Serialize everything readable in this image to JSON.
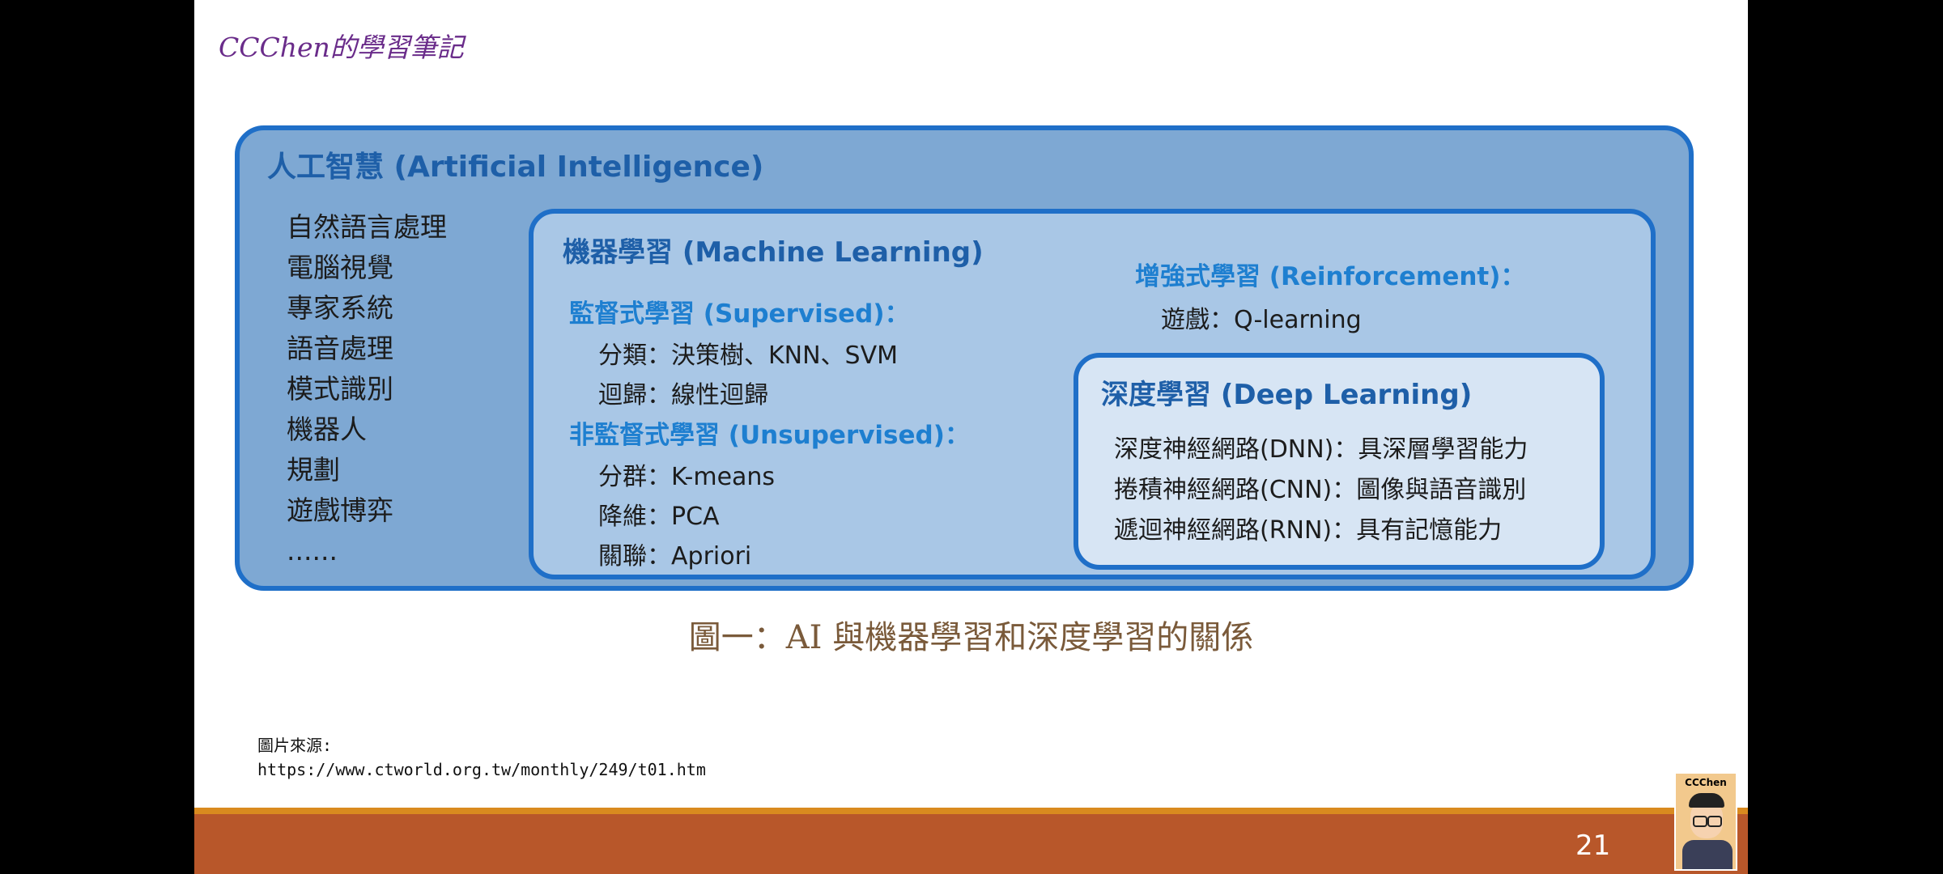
{
  "header": {
    "brand": "CCChen的學習筆記"
  },
  "diagram": {
    "ai": {
      "title": "人工智慧 (Artificial Intelligence)",
      "items": [
        "自然語言處理",
        "電腦視覺",
        "專家系統",
        "語音處理",
        "模式識別",
        "機器人",
        "規劃",
        "遊戲博弈",
        "......"
      ]
    },
    "ml": {
      "title": "機器學習 (Machine Learning)",
      "supervised": {
        "title": "監督式學習 (Supervised)：",
        "items": [
          "分類：決策樹、KNN、SVM",
          "迴歸：線性迴歸"
        ]
      },
      "unsupervised": {
        "title": "非監督式學習 (Unsupervised)：",
        "items": [
          "分群：K-means",
          "降維：PCA",
          "關聯：Apriori"
        ]
      },
      "reinforcement": {
        "title": "增強式學習 (Reinforcement)：",
        "items": [
          "遊戲：Q-learning"
        ]
      }
    },
    "dl": {
      "title": "深度學習 (Deep Learning)",
      "items": [
        "深度神經網路(DNN)：具深層學習能力",
        "捲積神經網路(CNN)：圖像與語音識別",
        "遞迴神經網路(RNN)：具有記憶能力"
      ]
    }
  },
  "caption": "圖一：AI 與機器學習和深度學習的關係",
  "source": {
    "label": "圖片來源:",
    "url": "https://www.ctworld.org.tw/monthly/249/t01.htm"
  },
  "footer": {
    "page_number": "21",
    "avatar_label": "CCChen"
  },
  "colors": {
    "border": "#1f6fc8",
    "ai_fill": "#7ea8d3",
    "ml_fill": "#a9c7e6",
    "dl_fill": "#d7e5f4",
    "footer_bar": "#b8572a"
  }
}
